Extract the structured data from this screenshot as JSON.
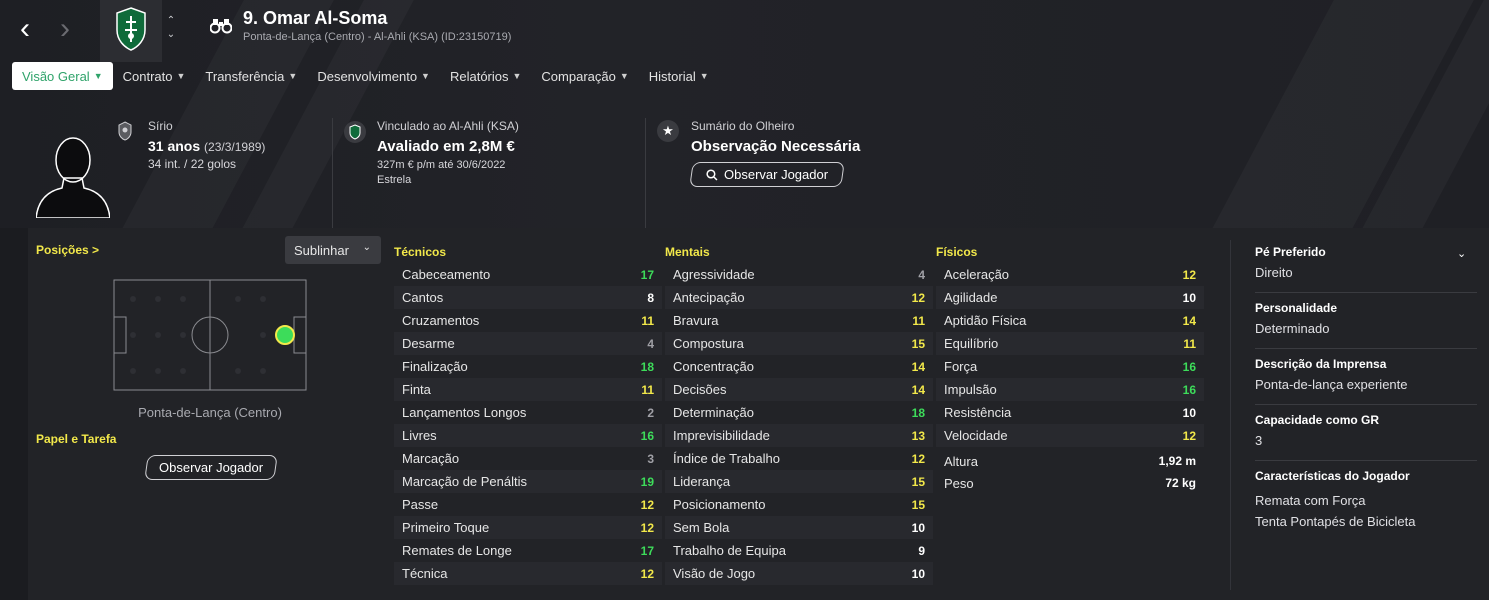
{
  "header": {
    "player_name": "9. Omar Al-Soma",
    "player_subtitle": "Ponta-de-Lança (Centro) - Al-Ahli (KSA) (ID:23150719)"
  },
  "tabs": [
    {
      "label": "Visão Geral"
    },
    {
      "label": "Contrato"
    },
    {
      "label": "Transferência"
    },
    {
      "label": "Desenvolvimento"
    },
    {
      "label": "Relatórios"
    },
    {
      "label": "Comparação"
    },
    {
      "label": "Historial"
    }
  ],
  "info": {
    "nationality": "Sírio",
    "age": "31 anos",
    "dob": "(23/3/1989)",
    "caps": "34 int. / 22 golos",
    "club_label": "Vinculado ao Al-Ahli (KSA)",
    "value": "Avaliado em 2,8M €",
    "wage": "327m € p/m até 30/6/2022",
    "status": "Estrela",
    "scout_label": "Sumário do Olheiro",
    "scout_value": "Observação Necessária",
    "scout_button": "Observar Jogador"
  },
  "positions": {
    "title": "Posições >",
    "dropdown": "Sublinhar",
    "caption": "Ponta-de-Lança (Centro)",
    "role_title": "Papel e Tarefa",
    "scout_button": "Observar Jogador"
  },
  "colors": {
    "high": "#3ddc5a",
    "mid": "#f2e84a",
    "low": "#ffffff",
    "dim": "#a0a0a6"
  },
  "technical": {
    "title": "Técnicos",
    "rows": [
      {
        "name": "Cabeceamento",
        "value": "17"
      },
      {
        "name": "Cantos",
        "value": "8"
      },
      {
        "name": "Cruzamentos",
        "value": "11"
      },
      {
        "name": "Desarme",
        "value": "4"
      },
      {
        "name": "Finalização",
        "value": "18"
      },
      {
        "name": "Finta",
        "value": "11"
      },
      {
        "name": "Lançamentos Longos",
        "value": "2"
      },
      {
        "name": "Livres",
        "value": "16"
      },
      {
        "name": "Marcação",
        "value": "3"
      },
      {
        "name": "Marcação de Penáltis",
        "value": "19"
      },
      {
        "name": "Passe",
        "value": "12"
      },
      {
        "name": "Primeiro Toque",
        "value": "12"
      },
      {
        "name": "Remates de Longe",
        "value": "17"
      },
      {
        "name": "Técnica",
        "value": "12"
      }
    ]
  },
  "mental": {
    "title": "Mentais",
    "rows": [
      {
        "name": "Agressividade",
        "value": "4"
      },
      {
        "name": "Antecipação",
        "value": "12"
      },
      {
        "name": "Bravura",
        "value": "11"
      },
      {
        "name": "Compostura",
        "value": "15"
      },
      {
        "name": "Concentração",
        "value": "14"
      },
      {
        "name": "Decisões",
        "value": "14"
      },
      {
        "name": "Determinação",
        "value": "18"
      },
      {
        "name": "Imprevisibilidade",
        "value": "13"
      },
      {
        "name": "Índice de Trabalho",
        "value": "12"
      },
      {
        "name": "Liderança",
        "value": "15"
      },
      {
        "name": "Posicionamento",
        "value": "15"
      },
      {
        "name": "Sem Bola",
        "value": "10"
      },
      {
        "name": "Trabalho de Equipa",
        "value": "9"
      },
      {
        "name": "Visão de Jogo",
        "value": "10"
      }
    ]
  },
  "physical": {
    "title": "Físicos",
    "rows": [
      {
        "name": "Aceleração",
        "value": "12"
      },
      {
        "name": "Agilidade",
        "value": "10"
      },
      {
        "name": "Aptidão Física",
        "value": "14"
      },
      {
        "name": "Equilíbrio",
        "value": "11"
      },
      {
        "name": "Força",
        "value": "16"
      },
      {
        "name": "Impulsão",
        "value": "16"
      },
      {
        "name": "Resistência",
        "value": "10"
      },
      {
        "name": "Velocidade",
        "value": "12"
      }
    ],
    "height_label": "Altura",
    "height": "1,92 m",
    "weight_label": "Peso",
    "weight": "72 kg"
  },
  "details": [
    {
      "title": "Pé Preferido",
      "values": [
        "Direito"
      ]
    },
    {
      "title": "Personalidade",
      "values": [
        "Determinado"
      ]
    },
    {
      "title": "Descrição da Imprensa",
      "values": [
        "Ponta-de-lança experiente"
      ]
    },
    {
      "title": "Capacidade como GR",
      "values": [
        "3"
      ]
    },
    {
      "title": "Características do Jogador",
      "values": [
        "Remata com Força",
        "Tenta Pontapés de Bicicleta"
      ]
    }
  ]
}
